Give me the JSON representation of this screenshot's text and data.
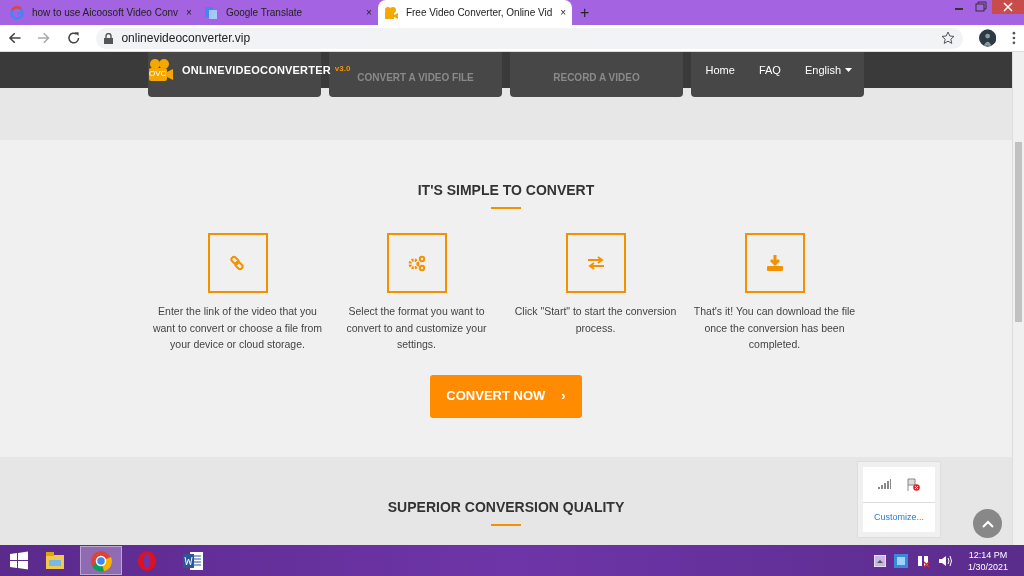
{
  "browser": {
    "tabs": [
      {
        "title": "how to use Aicoosoft Video Conv",
        "close": "×",
        "selected": false
      },
      {
        "title": "Google Translate",
        "close": "×",
        "selected": false
      },
      {
        "title": "Free Video Converter, Online Vid",
        "close": "×",
        "selected": true
      }
    ],
    "new_tab": "+",
    "url": "onlinevideoconverter.vip"
  },
  "site": {
    "logo": {
      "badge": "OVC",
      "name": "ONLINEVIDEOCONVERTER",
      "version": "v3.0"
    },
    "cards": [
      {
        "kind": "blank"
      },
      {
        "kind": "labeled",
        "label": "CONVERT A VIDEO FILE"
      },
      {
        "kind": "labeled",
        "label": "RECORD A VIDEO"
      },
      {
        "kind": "blank"
      }
    ],
    "nav": [
      {
        "label": "Home",
        "kind": "link"
      },
      {
        "label": "FAQ",
        "kind": "link"
      },
      {
        "label": "English",
        "kind": "dropdown"
      }
    ],
    "steps_section": {
      "title": "IT'S SIMPLE TO CONVERT",
      "steps": [
        {
          "text": "Enter the link of the video that you want to convert or choose a file from your device or cloud storage."
        },
        {
          "text": "Select the format you want to convert to and customize your settings."
        },
        {
          "text": "Click \"Start\" to start the conversion process."
        },
        {
          "text": "That's it! You can download the file once the conversion has been completed."
        }
      ],
      "button": "CONVERT NOW",
      "button_arrow": "›"
    },
    "quality_section": {
      "title": "SUPERIOR CONVERSION QUALITY"
    }
  },
  "tray_popup": {
    "customize": "Customize..."
  },
  "taskbar": {
    "apps": [
      {
        "kind": "explorer",
        "selected": false
      },
      {
        "kind": "chrome",
        "selected": true
      },
      {
        "kind": "opera",
        "selected": false
      },
      {
        "kind": "word",
        "selected": false
      }
    ],
    "time": "12:14 PM",
    "date": "1/30/2021"
  }
}
